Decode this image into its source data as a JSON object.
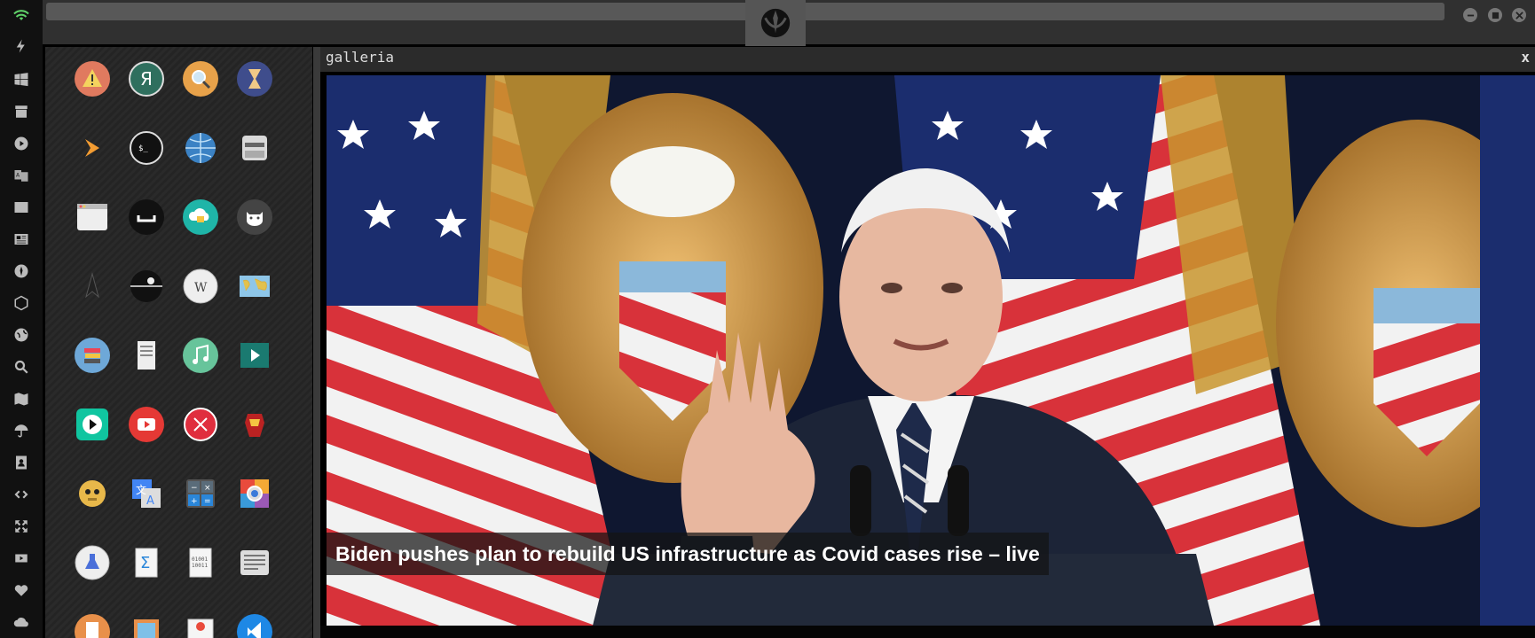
{
  "window": {
    "title": ""
  },
  "gallery": {
    "title": "galleria",
    "close_label": "x",
    "caption": "Biden pushes plan to rebuild US infrastructure as Covid cases rise – live"
  },
  "colors": {
    "accent_wifi": "#5fd068",
    "rail_bg": "#111111",
    "topbar_bg": "#303030"
  },
  "rail_icons": [
    "wifi-icon",
    "flash-icon",
    "windows-icon",
    "archive-icon",
    "play-icon",
    "translate-icon",
    "image-icon",
    "news-icon",
    "rebel-icon",
    "hexagon-icon",
    "globe-icon",
    "search-icon",
    "map-icon",
    "umbrella-icon",
    "contacts-icon",
    "code-icon",
    "expand-icon",
    "youtube-icon",
    "heart-icon",
    "cloud-icon"
  ],
  "apps": [
    [
      "warning-app",
      "yandex-app",
      "search-app",
      "hourglass-app"
    ],
    [
      "sublime-app",
      "terminal-app",
      "globe-app",
      "scanner-app"
    ],
    [
      "window-app",
      "ubuntu-app",
      "cloud-lock-app",
      "github-app"
    ],
    [
      "startrek-app",
      "deathstar-app",
      "wikipedia-app",
      "worldmap-app"
    ],
    [
      "books-app",
      "notes-app",
      "music-app",
      "video-app"
    ],
    [
      "player-app",
      "youtube-app",
      "close-app",
      "ironman-app"
    ],
    [
      "c3po-app",
      "translate-app",
      "calculator-app",
      "photo-app"
    ],
    [
      "lab-app",
      "sigma-app",
      "binary-app",
      "text-app"
    ],
    [
      "doc-app",
      "image-app",
      "slides-app",
      "vscode-app"
    ]
  ]
}
